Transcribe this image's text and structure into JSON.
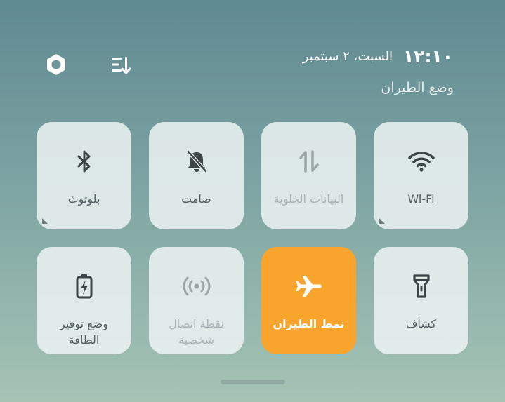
{
  "header": {
    "time": "١٢:١٠",
    "date": "السبت، ٢ سبتمبر",
    "mode_status": "وضع الطيران",
    "settings_icon": "settings-gear-icon",
    "sort_icon": "sort-edit-icon"
  },
  "tiles": [
    {
      "label": "Wi-Fi",
      "icon": "wifi-icon",
      "state": "off",
      "has_submenu": true
    },
    {
      "label": "البيانات الخلوية",
      "icon": "mobile-data-icon",
      "state": "disabled"
    },
    {
      "label": "صامت",
      "icon": "bell-muted-icon",
      "state": "off"
    },
    {
      "label": "بلوتوث",
      "icon": "bluetooth-icon",
      "state": "off",
      "has_submenu": true
    },
    {
      "label": "كشاف",
      "icon": "flashlight-icon",
      "state": "off"
    },
    {
      "label": "نمط الطيران",
      "icon": "airplane-icon",
      "state": "on"
    },
    {
      "label_line1": "نقطة اتصال",
      "label_line2": "شخصية",
      "icon": "hotspot-icon",
      "state": "disabled"
    },
    {
      "label_line1": "وضع توفير",
      "label_line2": "الطاقة",
      "icon": "battery-saver-icon",
      "state": "off"
    }
  ],
  "colors": {
    "active": "#f9a42d",
    "tile": "#ecf2f2"
  }
}
